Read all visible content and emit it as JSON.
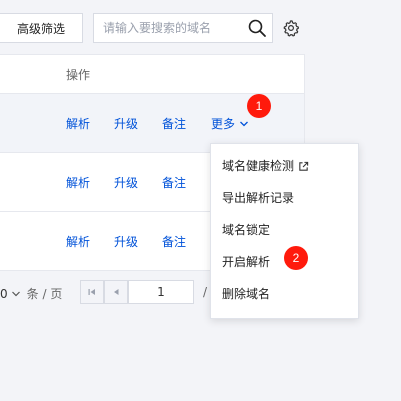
{
  "toolbar": {
    "advanced_filter_label": "高级筛选",
    "search_placeholder": "请输入要搜索的域名",
    "search_icon": "search-icon",
    "settings_icon": "gear-icon"
  },
  "table": {
    "columns": [
      "操作"
    ],
    "rows": [
      {
        "actions": [
          "解析",
          "升级",
          "备注",
          "更多"
        ]
      },
      {
        "actions": [
          "解析",
          "升级",
          "备注"
        ]
      },
      {
        "actions": [
          "解析",
          "升级",
          "备注"
        ]
      }
    ]
  },
  "more_menu": {
    "items": [
      {
        "label": "域名健康检测",
        "icon": "external-link-icon"
      },
      {
        "label": "导出解析记录"
      },
      {
        "label": "域名锁定"
      },
      {
        "label": "开启解析"
      },
      {
        "label": "删除域名"
      }
    ]
  },
  "pagination": {
    "page_size_partial": "0",
    "page_size_unit": "条 / 页",
    "current_page": "1",
    "separator": "/"
  },
  "badges": [
    "1",
    "2"
  ],
  "colors": {
    "link": "#0052d9",
    "badge": "#ff1a0c",
    "background": "#f3f4f8"
  }
}
